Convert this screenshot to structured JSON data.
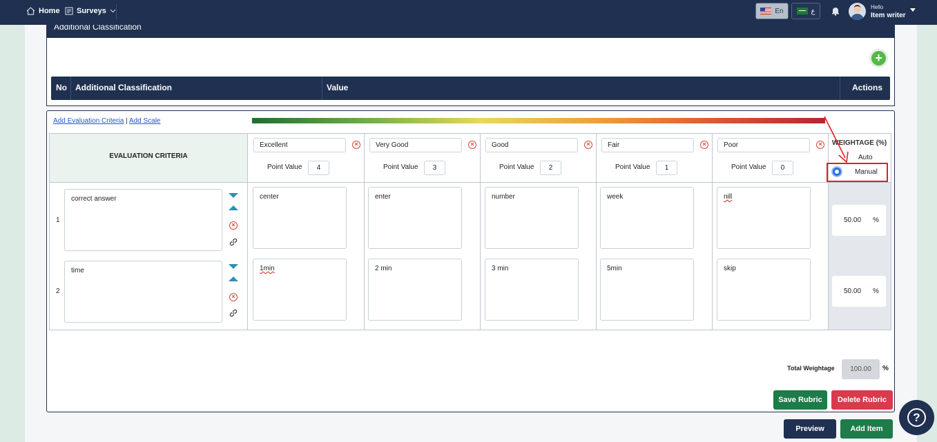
{
  "nav": {
    "home": "Home",
    "surveys": "Surveys",
    "lang_en": "En",
    "lang_ar": "ع",
    "user_hello": "Hello",
    "user_name": "Item writer"
  },
  "classification": {
    "title": "Additional Classification",
    "col_no": "No",
    "col_name": "Additional Classification",
    "col_value": "Value",
    "col_actions": "Actions"
  },
  "rubric": {
    "add_criteria": "Add Evaluation Criteria",
    "separator": "|",
    "add_scale": "Add Scale",
    "criteria_header": "EVALUATION CRITERIA",
    "point_value_label": "Point Value",
    "scales": [
      {
        "name": "Excellent",
        "points": "4"
      },
      {
        "name": "Very Good",
        "points": "3"
      },
      {
        "name": "Good",
        "points": "2"
      },
      {
        "name": "Fair",
        "points": "1"
      },
      {
        "name": "Poor",
        "points": "0"
      }
    ],
    "weightage_title": "WEIGHTAGE (%)",
    "auto_label": "Auto",
    "manual_label": "Manual",
    "rows": [
      {
        "no": "1",
        "criteria": "correct answer",
        "cells": [
          "center",
          "enter",
          "number",
          "week",
          "nill"
        ],
        "weight": "50.00",
        "pct": "%"
      },
      {
        "no": "2",
        "criteria": "time",
        "cells": [
          "1min",
          "2 min",
          "3 min",
          "5min",
          "skip"
        ],
        "weight": "50.00",
        "pct": "%"
      }
    ],
    "total_label": "Total Weightage",
    "total_value": "100.00",
    "total_pct": "%",
    "save_label": "Save Rubric",
    "delete_label": "Delete Rubric"
  },
  "footer": {
    "preview_label": "Preview",
    "add_item_label": "Add Item",
    "help_icon": "?"
  },
  "colors": {
    "navy": "#1f3050",
    "green": "#1e7b4a",
    "red": "#da3a4e",
    "highlight": "#e02020"
  }
}
